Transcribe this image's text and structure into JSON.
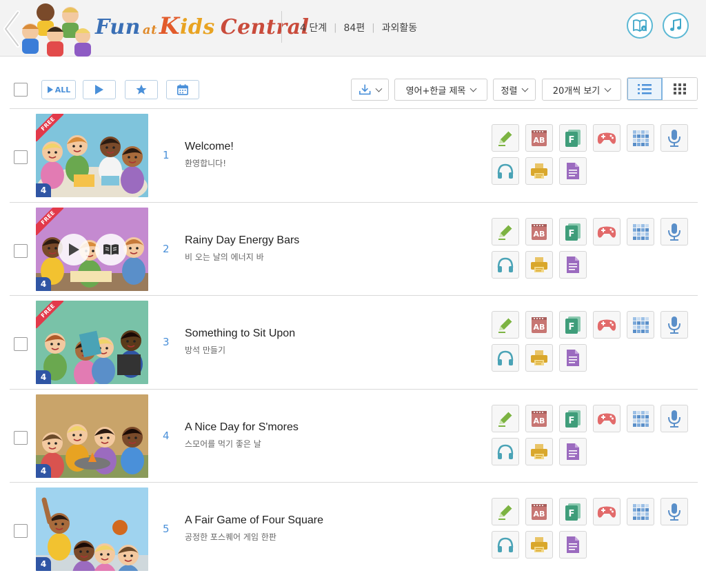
{
  "header": {
    "logo": {
      "fun": "Fun",
      "at": "at",
      "k1": "K",
      "k2": "ids",
      "central": "Central"
    },
    "info": {
      "level": "4 단계",
      "count": "84편",
      "category": "과외활동"
    },
    "icons": [
      "chevron-left-icon",
      "book-info-icon",
      "music-note-icon"
    ]
  },
  "toolbar": {
    "play_all_label": "ALL",
    "dropdowns": {
      "title_mode": "영어+한글 제목",
      "sort": "정렬",
      "page_size": "20개씩 보기"
    }
  },
  "colors": {
    "accent": "#4a90d9",
    "badge": "#2f55a4",
    "free": "#e2394a",
    "pencil": "#7cb342",
    "wordbook": "#c77673",
    "flashcard": "#3f9d7a",
    "game": "#e26a6a",
    "puzzle": "#5a8fc9",
    "mic": "#5a8fc9",
    "headphones": "#4aa3b6",
    "printer": "#d9a72c",
    "document": "#9b6bbf"
  },
  "items": [
    {
      "num": "1",
      "title": "Welcome!",
      "subtitle": "환영합니다!",
      "level": "4",
      "free": true,
      "free_label": "FREE",
      "bg": "#7fc4dc"
    },
    {
      "num": "2",
      "title": "Rainy Day Energy Bars",
      "subtitle": "비 오는 날의 에너지 바",
      "level": "4",
      "free": true,
      "free_label": "FREE",
      "bg": "#c48ad0"
    },
    {
      "num": "3",
      "title": "Something to Sit Upon",
      "subtitle": "방석 만들기",
      "level": "4",
      "free": true,
      "free_label": "FREE",
      "bg": "#79c2a8"
    },
    {
      "num": "4",
      "title": "A Nice Day for S'mores",
      "subtitle": "스모어를 먹기 좋은 날",
      "level": "4",
      "free": false,
      "free_label": "",
      "bg": "#c9a46a"
    },
    {
      "num": "5",
      "title": "A Fair Game of Four Square",
      "subtitle": "공정한 포스퀘어 게임 한판",
      "level": "4",
      "free": false,
      "free_label": "",
      "bg": "#9fd3ef"
    }
  ],
  "activity_icons": [
    "pencil-icon",
    "wordbook-icon",
    "flashcard-icon",
    "game-icon",
    "puzzle-icon",
    "microphone-icon",
    "headphones-icon",
    "printer-icon",
    "document-icon"
  ]
}
